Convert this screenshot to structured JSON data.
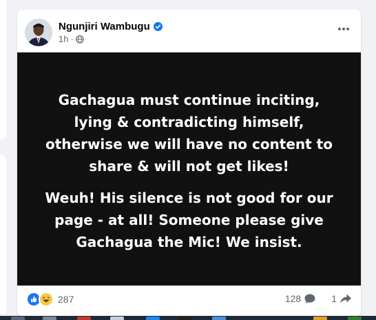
{
  "post": {
    "author": "Ngunjiri Wambugu",
    "verified": true,
    "time": "1h",
    "audience_icon": "globe-icon",
    "more_icon": "more-options-icon",
    "image_text": {
      "paragraph1": [
        "Gachagua must continue inciting,",
        "lying & contradicting himself,",
        "otherwise we will have no content to",
        "share & will not get likes!"
      ],
      "paragraph2": [
        "Weuh! His silence is not good for our",
        "page - at all! Someone please give",
        "Gachagua the Mic! We insist."
      ]
    },
    "reactions": {
      "icons": [
        "like-icon",
        "haha-icon"
      ],
      "count": "287"
    },
    "comments_count": "128",
    "shares_count": "1"
  },
  "colors": {
    "page_bg": "#f0f2f5",
    "card_bg": "#ffffff",
    "image_bg": "#111111",
    "like_blue": "#1877f2",
    "haha_yellow": "#f7c948",
    "meta_gray": "#65676b"
  }
}
